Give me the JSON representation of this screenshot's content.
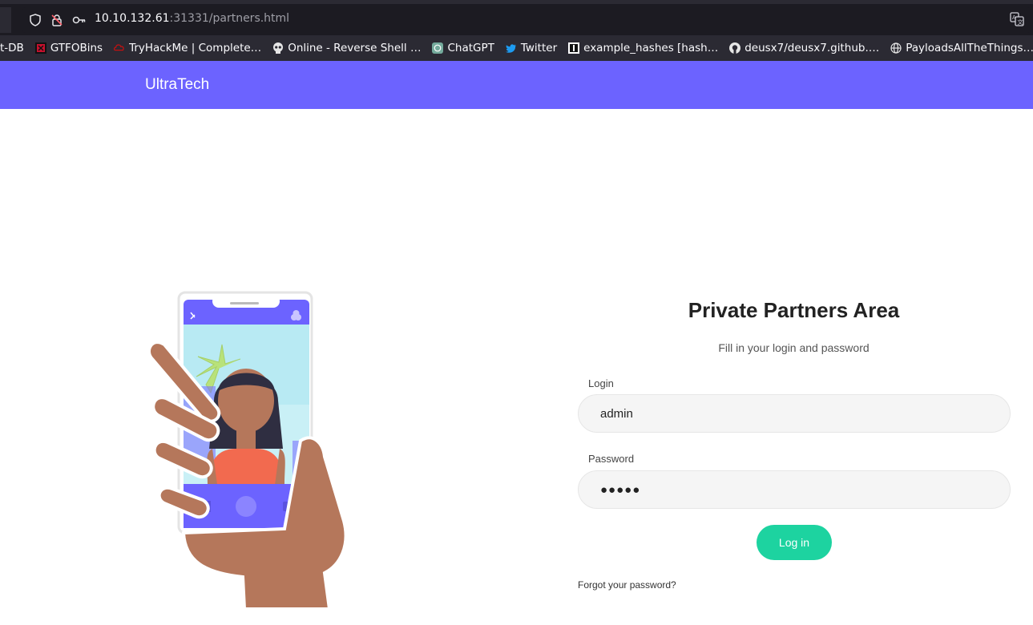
{
  "browser": {
    "url_host": "10.10.132.61",
    "url_path": ":31331/partners.html",
    "bookmarks": [
      {
        "label": "t-DB",
        "icon": "none"
      },
      {
        "label": "GTFOBins",
        "icon": "gtfobins-icon"
      },
      {
        "label": "TryHackMe | Complete…",
        "icon": "tryhackme-icon"
      },
      {
        "label": "Online - Reverse Shell …",
        "icon": "skull-icon"
      },
      {
        "label": "ChatGPT",
        "icon": "chatgpt-icon"
      },
      {
        "label": "Twitter",
        "icon": "twitter-icon"
      },
      {
        "label": "example_hashes [hash…",
        "icon": "hashcat-icon"
      },
      {
        "label": "deusx7/deusx7.github.…",
        "icon": "github-icon"
      },
      {
        "label": "PayloadsAllTheThings…",
        "icon": "globe-icon"
      }
    ]
  },
  "nav": {
    "brand": "UltraTech",
    "color": "#6c63ff"
  },
  "form": {
    "title": "Private Partners Area",
    "subtitle": "Fill in your login and password",
    "login_label": "Login",
    "login_value": "admin",
    "password_label": "Password",
    "password_value": "●●●●●",
    "submit_label": "Log in",
    "forgot_label": "Forgot your password?",
    "button_color": "#1dd3a0"
  }
}
